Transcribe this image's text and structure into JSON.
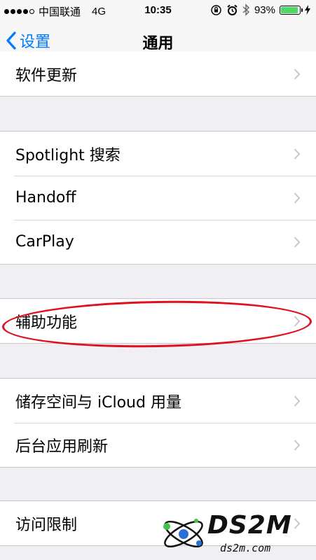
{
  "status_bar": {
    "carrier": "中国联通",
    "network": "4G",
    "time": "10:35",
    "battery": "93%",
    "battery_level": 0.93,
    "battery_color": "#4cd964"
  },
  "nav": {
    "back_label": "设置",
    "title": "通用",
    "accent": "#007aff"
  },
  "groups": [
    {
      "items": [
        {
          "label": "软件更新"
        }
      ]
    },
    {
      "items": [
        {
          "label": "Spotlight 搜索"
        },
        {
          "label": "Handoff"
        },
        {
          "label": "CarPlay"
        }
      ]
    },
    {
      "items": [
        {
          "label": "辅助功能"
        }
      ]
    },
    {
      "items": [
        {
          "label": "储存空间与 iCloud 用量"
        },
        {
          "label": "后台应用刷新"
        }
      ]
    },
    {
      "items": [
        {
          "label": "访问限制"
        }
      ]
    }
  ],
  "annotation": {
    "color": "#e0101e"
  },
  "watermark": {
    "logo_text": "DS2M",
    "url": "ds2m.com"
  }
}
